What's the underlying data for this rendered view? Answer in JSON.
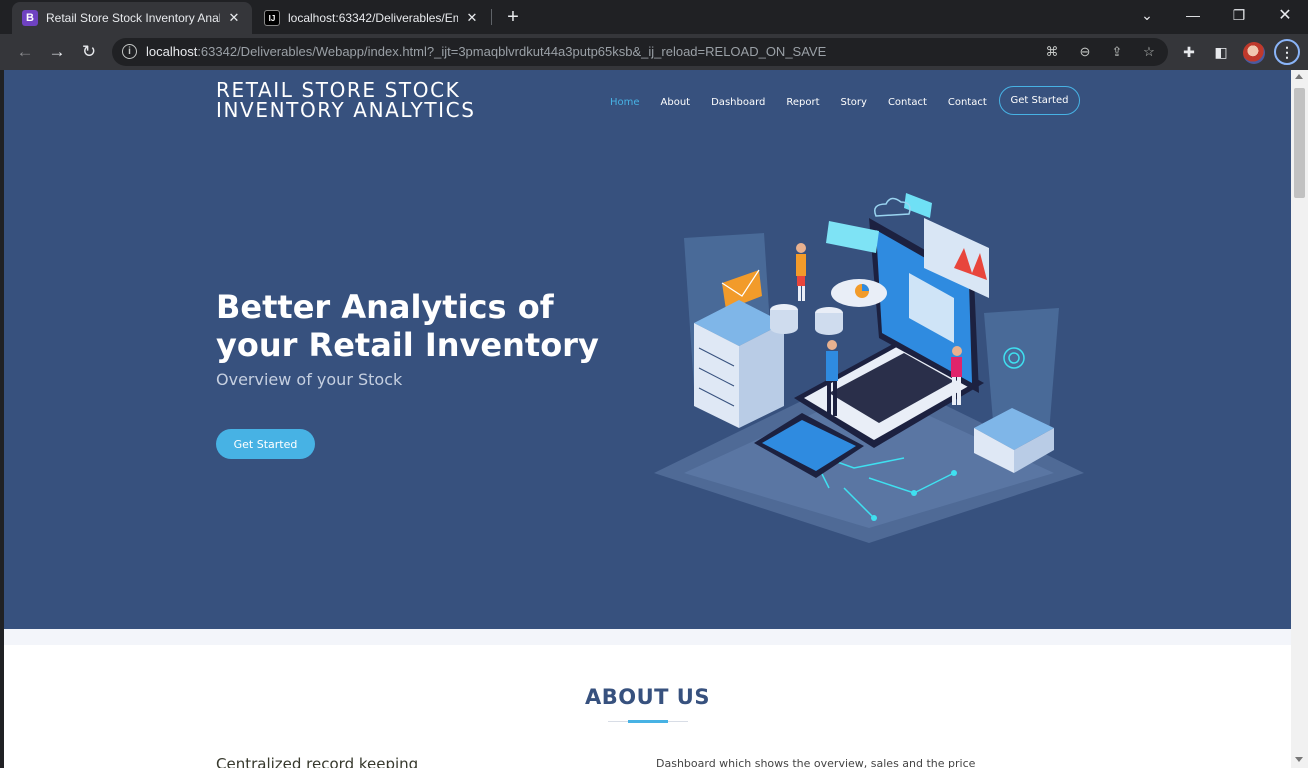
{
  "browser": {
    "tabs": [
      {
        "title": "Retail Store Stock Inventory Analy",
        "favicon": "B",
        "active": true
      },
      {
        "title": "localhost:63342/Deliverables/Em",
        "favicon": "IJ",
        "active": false
      }
    ],
    "url_host": "localhost",
    "url_rest": ":63342/Deliverables/Webapp/index.html?_ijt=3pmaqblvrdkut44a3putp65ksb&_ij_reload=RELOAD_ON_SAVE"
  },
  "site": {
    "brand": "RETAIL STORE STOCK INVENTORY ANALYTICS",
    "nav": [
      "Home",
      "About",
      "Dashboard",
      "Report",
      "Story",
      "Contact",
      "Contact"
    ],
    "nav_cta": "Get Started",
    "hero": {
      "title": "Better Analytics of your Retail Inventory",
      "subtitle": "Overview of your Stock",
      "button": "Get Started"
    },
    "about": {
      "title": "ABOUT US",
      "left_text": "Centralized record keeping",
      "right_text": "Dashboard which shows the overview, sales and the price"
    }
  },
  "colors": {
    "hero_bg": "#37517e",
    "accent": "#47b2e4",
    "chrome_dark": "#202124",
    "chrome_tab": "#35363a"
  }
}
